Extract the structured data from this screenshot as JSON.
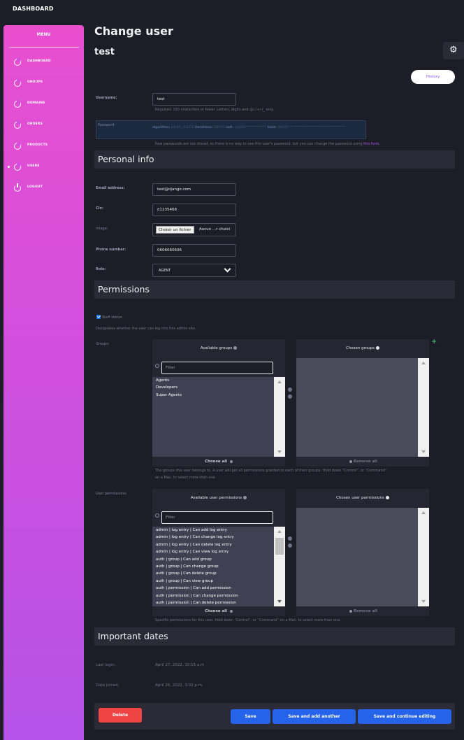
{
  "topbar": {
    "brand": "DASHBOARD"
  },
  "sidebar": {
    "title": "MENU",
    "items": [
      {
        "label": "DASHBOARD",
        "icon": "pie-chart-icon"
      },
      {
        "label": "GROUPS",
        "icon": "pie-chart-icon"
      },
      {
        "label": "DOMAINS",
        "icon": "pie-chart-icon"
      },
      {
        "label": "ORDERS",
        "icon": "pie-chart-icon"
      },
      {
        "label": "PRODUCTS",
        "icon": "pie-chart-icon"
      },
      {
        "label": "USERS",
        "icon": "pie-chart-icon",
        "active": true
      },
      {
        "label": "LOGOUT",
        "icon": "power-icon"
      }
    ]
  },
  "header": {
    "title": "Change user",
    "object": "test",
    "history_label": "History",
    "gear_icon": "gear-icon"
  },
  "form": {
    "username": {
      "label": "Username:",
      "value": "test",
      "help": "Required. 150 characters or fewer. Letters, digits and @/./+/-/_ only."
    },
    "password": {
      "label": "Password:",
      "algorithm_label": "algorithm:",
      "algorithm": "pbkdf2_sha256",
      "iterations_label": "iterations:",
      "iterations": "260000",
      "salt_label": "salt:",
      "salt": "zngSWi**************",
      "hash_label": "hash:",
      "hash": "iJHs1Q**************************************",
      "help_prefix": "Raw passwords are not stored, so there is no way to see this user's password, but you can change the password using ",
      "help_link": "this form",
      "help_suffix": "."
    },
    "personal_info": {
      "section_title": "Personal info",
      "email": {
        "label": "Email address:",
        "value": "test@django.com"
      },
      "cin": {
        "label": "Cin:",
        "value": "d1235468"
      },
      "image": {
        "label": "Image:",
        "button": "Choisir un fichier",
        "status": "Aucun ...r choisi"
      },
      "phone": {
        "label": "Phone number:",
        "value": "0606060606"
      },
      "role": {
        "label": "Role:",
        "value": "AGENT"
      }
    },
    "permissions": {
      "section_title": "Permissions",
      "staff": {
        "label": "Staff status",
        "checked": true,
        "help": "Designates whether the user can log into this admin site."
      },
      "groups": {
        "label": "Groups:",
        "available_title": "Available groups",
        "filter_placeholder": "Filter",
        "available": [
          "Agents",
          "Developers",
          "Super Agents"
        ],
        "choose_all": "Choose all",
        "chosen_title": "Chosen groups",
        "remove_all": "Remove all",
        "help_line1": "The groups this user belongs to. A user will get all permissions granted to each of their groups. Hold down “Control”, or “Command”",
        "help_line2": "on a Mac, to select more than one."
      },
      "user_permissions": {
        "label": "User permissions:",
        "available_title": "Available user permissions",
        "filter_placeholder": "Filter",
        "available": [
          "admin | log entry | Can add log entry",
          "admin | log entry | Can change log entry",
          "admin | log entry | Can delete log entry",
          "admin | log entry | Can view log entry",
          "auth | group | Can add group",
          "auth | group | Can change group",
          "auth | group | Can delete group",
          "auth | group | Can view group",
          "auth | permission | Can add permission",
          "auth | permission | Can change permission",
          "auth | permission | Can delete permission"
        ],
        "choose_all": "Choose all",
        "chosen_title": "Chosen user permissions",
        "remove_all": "Remove all",
        "help": "Specific permissions for this user. Hold down “Control”, or “Command” on a Mac, to select more than one."
      }
    },
    "important_dates": {
      "section_title": "Important dates",
      "last_login": {
        "label": "Last login:",
        "value": "April 27, 2022, 10:15 a.m."
      },
      "date_joined": {
        "label": "Date joined:",
        "value": "April 26, 2022, 3:02 p.m."
      }
    }
  },
  "actions": {
    "delete": "Delete",
    "save": "Save",
    "save_add": "Save and add another",
    "save_continue": "Save and continue editing"
  },
  "colors": {
    "background": "#1c1d26",
    "panel": "#2a2b36",
    "sidebar_top": "#e84fcf",
    "sidebar_bottom": "#b552e8",
    "primary": "#2563eb",
    "danger": "#ef4444",
    "link": "#a855f7"
  }
}
